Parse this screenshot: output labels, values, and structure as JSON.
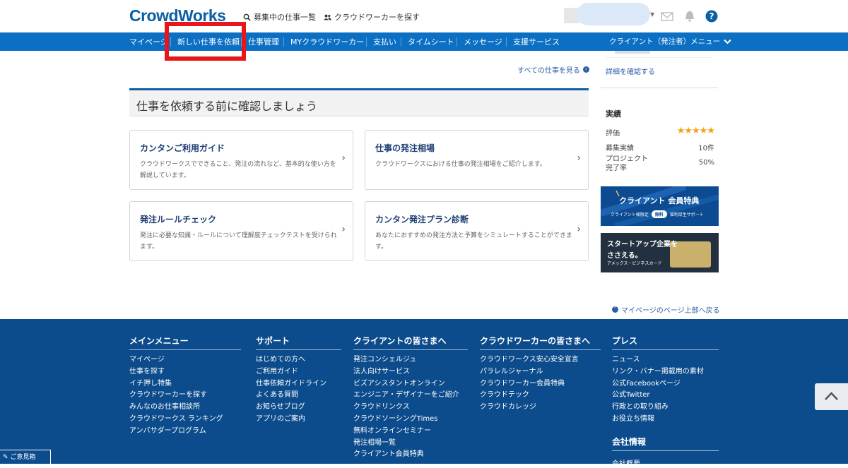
{
  "header": {
    "logo": "CrowdWorks",
    "search_jobs_label": "募集中の仕事一覧",
    "search_workers_label": "クラウドワーカーを探す"
  },
  "nav": {
    "items": [
      "マイページ",
      "新しい仕事を依頼",
      "仕事管理",
      "MYクラウドワーカー",
      "支払い",
      "タイムシート",
      "メッセージ",
      "支援サービス"
    ],
    "client_menu": "クライアント（発注者）メニュー"
  },
  "main": {
    "all_jobs_link": "すべての仕事を見る",
    "section_title": "仕事を依頼する前に確認しましょう",
    "cards": [
      {
        "title": "カンタンご利用ガイド",
        "desc": "クラウドワークスでできること、発注の流れなど、基本的な使い方を解説しています。"
      },
      {
        "title": "仕事の発注相場",
        "desc": "クラウドワークスにおける仕事の発注相場をご紹介します。"
      },
      {
        "title": "発注ルールチェック",
        "desc": "発注に必要な知識・ルールについて理解度チェックテストを受けられます。"
      },
      {
        "title": "カンタン発注プラン診断",
        "desc": "あなたにおすすめの発注方法と予算をシミュレートすることができます。"
      }
    ],
    "back_to_top": "マイページのページ上部へ戻る"
  },
  "sidebar": {
    "detail_link": "詳細を確認する",
    "results_title": "実績",
    "rating_label": "評価",
    "rating_stars": 5,
    "rating_glyphs": "★★★★★",
    "recruit_label": "募集実績",
    "recruit_value": "10件",
    "completion_label_1": "プロジェクト",
    "completion_label_2": "完了率",
    "completion_value": "50%",
    "banner1": {
      "title": "クライアント 会員特典",
      "sub1": "クライアント様限定",
      "pill": "無料",
      "sub2": "福利厚生サポート"
    },
    "banner2": {
      "line1": "スタートアップ企業を",
      "line2": "ささえる。",
      "line3": "アメックス・ビジネスカード"
    }
  },
  "footer": {
    "columns": [
      {
        "title": "メインメニュー",
        "items": [
          "マイページ",
          "仕事を探す",
          "イチ押し特集",
          "クラウドワーカーを探す",
          "みんなのお仕事相談所",
          "クラウドワークス ランキング",
          "アンバサダープログラム"
        ]
      },
      {
        "title": "サポート",
        "items": [
          "はじめての方へ",
          "ご利用ガイド",
          "仕事依頼ガイドライン",
          "よくある質問",
          "お知らせブログ",
          "アプリのご案内"
        ]
      },
      {
        "title": "クライアントの皆さまへ",
        "items": [
          "発注コンシェルジュ",
          "法人向けサービス",
          "ビズアシスタントオンライン",
          "エンジニア・デザイナーをご紹介",
          "クラウドリンクス",
          "クラウドソーシングTimes",
          "無料オンラインセミナー",
          "発注相場一覧",
          "クライアント会員特典"
        ]
      },
      {
        "title": "クラウドワーカーの皆さまへ",
        "items": [
          "クラウドワークス安心安全宣言",
          "パラレルジャーナル",
          "クラウドワーカー会員特典",
          "クラウドテック",
          "クラウドカレッジ"
        ]
      },
      {
        "title": "プレス",
        "items": [
          "ニュース",
          "リンク・バナー掲載用の素材",
          "公式Facebookページ",
          "公式Twitter",
          "行政との取り組み",
          "お役立ち情報"
        ]
      }
    ],
    "company_title": "会社情報",
    "company_first": "会社概要",
    "feedback": "ご意見箱"
  }
}
